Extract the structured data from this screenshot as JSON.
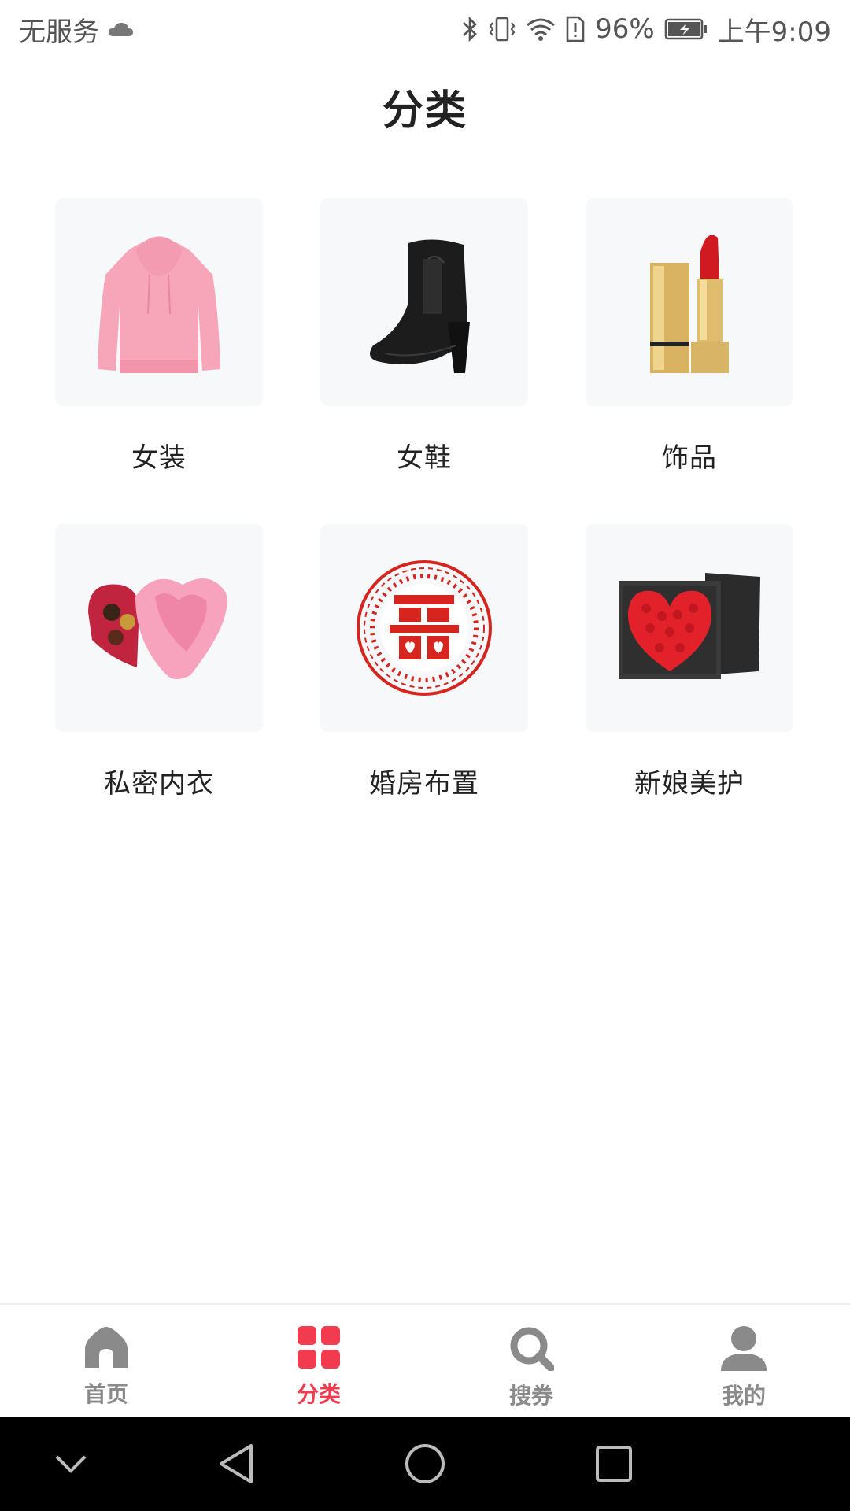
{
  "status_bar": {
    "carrier": "无服务",
    "battery_percent": "96%",
    "time": "上午9:09",
    "icons": [
      "cloud-icon",
      "bluetooth-icon",
      "vibrate-icon",
      "wifi-icon",
      "sim-alert-icon",
      "battery-icon"
    ]
  },
  "header": {
    "title": "分类"
  },
  "categories": [
    {
      "label": "女装",
      "icon": "pink-hoodie-image"
    },
    {
      "label": "女鞋",
      "icon": "black-boot-image"
    },
    {
      "label": "饰品",
      "icon": "lipstick-image"
    },
    {
      "label": "私密内衣",
      "icon": "heart-chocolate-box-image"
    },
    {
      "label": "婚房布置",
      "icon": "double-happiness-papercut-image"
    },
    {
      "label": "新娘美护",
      "icon": "rose-heart-box-image"
    }
  ],
  "tabs": [
    {
      "label": "首页",
      "icon": "home-icon",
      "active": false
    },
    {
      "label": "分类",
      "icon": "grid-icon",
      "active": true
    },
    {
      "label": "搜券",
      "icon": "search-icon",
      "active": false
    },
    {
      "label": "我的",
      "icon": "user-icon",
      "active": false
    }
  ],
  "colors": {
    "accent": "#f23b4f",
    "tab_inactive": "#8a8a8a",
    "thumb_bg": "#f7f8fa"
  }
}
